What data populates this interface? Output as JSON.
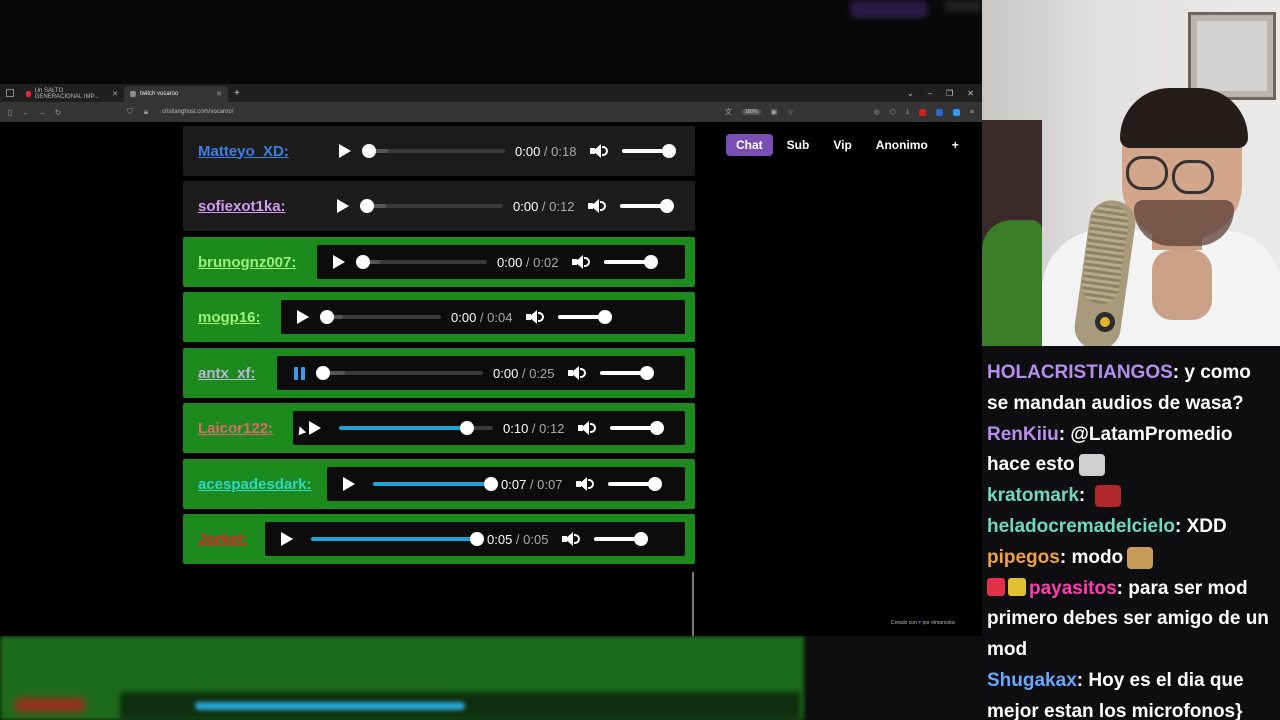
{
  "browser": {
    "tabs": [
      {
        "label": "Un SALTO GENERACIONAL IMP...",
        "active": false
      },
      {
        "label": "twitch vocaroo",
        "active": true
      }
    ],
    "url": "cristianghost.com/vocaroo/",
    "zoom": "100%"
  },
  "filters": [
    {
      "label": "Chat",
      "active": true
    },
    {
      "label": "Sub",
      "active": false
    },
    {
      "label": "Vip",
      "active": false
    },
    {
      "label": "Anonimo",
      "active": false
    },
    {
      "label": "+",
      "active": false
    }
  ],
  "audios": [
    {
      "user": "Matteyo_XD:",
      "name_color": "#3a7fe0",
      "style": "dark",
      "state": "play",
      "current": "0:00",
      "duration": "0:18",
      "progress": 0.0
    },
    {
      "user": "sofiexot1ka:",
      "name_color": "#d39bf0",
      "style": "dark",
      "state": "play",
      "current": "0:00",
      "duration": "0:12",
      "progress": 0.0
    },
    {
      "user": "brunognz007:",
      "name_color": "#9cf27a",
      "style": "green",
      "state": "play",
      "current": "0:00",
      "duration": "0:02",
      "progress": 0.0
    },
    {
      "user": "mogp16:",
      "name_color": "#9cf27a",
      "style": "green",
      "state": "play",
      "current": "0:00",
      "duration": "0:04",
      "progress": 0.0
    },
    {
      "user": "antx_xf:",
      "name_color": "#b6b8d6",
      "style": "green",
      "state": "pause",
      "current": "0:00",
      "duration": "0:25",
      "progress": 0.0
    },
    {
      "user": "Laicor122:",
      "name_color": "#e06a6a",
      "style": "green",
      "state": "play",
      "current": "0:10",
      "duration": "0:12",
      "progress": 0.83
    },
    {
      "user": "acespadesdark:",
      "name_color": "#2fd6c8",
      "style": "green",
      "state": "play",
      "current": "0:07",
      "duration": "0:07",
      "progress": 1.0
    },
    {
      "user": "Jorkel:",
      "name_color": "#e0202a",
      "style": "green",
      "state": "play",
      "current": "0:05",
      "duration": "0:05",
      "progress": 1.0
    }
  ],
  "footer": {
    "prefix": "Creado con",
    "suffix": "por elmarceloc"
  },
  "chat": [
    {
      "user": "HOLACRISTIANGOS",
      "color": "#b68ef0",
      "text": "y como se mandan audios de wasa?"
    },
    {
      "user": "RenKiiu",
      "color": "#b68ef0",
      "text": "@LatamPromedio hace esto",
      "emote": "#cfcfcf"
    },
    {
      "user": "kratomark",
      "color": "#6fd8c0",
      "text": "",
      "emote": "#b0282a"
    },
    {
      "user": "heladocremadelcielo",
      "color": "#6fd8c0",
      "text": "XDD"
    },
    {
      "user": "pipegos",
      "color": "#f0a040",
      "text": "modo",
      "emote": "#c79a58"
    },
    {
      "user": "payasitos",
      "color": "#ff3db0",
      "text": "para ser mod primero debes ser amigo de un mod",
      "badges": [
        "#e0304a",
        "#e0c030"
      ]
    },
    {
      "user": "Shugakax",
      "color": "#6aa8ff",
      "text": "Hoy es el dia que mejor estan los microfonos}"
    }
  ]
}
